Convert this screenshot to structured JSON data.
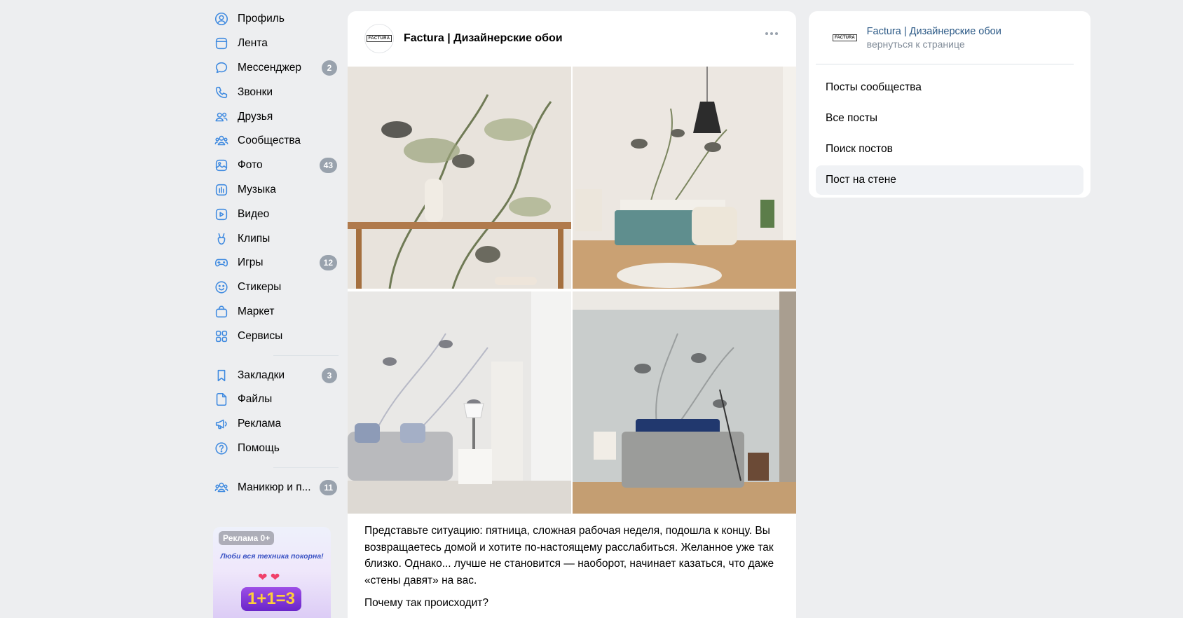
{
  "nav": {
    "items": [
      {
        "id": "profile",
        "label": "Профиль",
        "icon": "user-circle-icon",
        "badge": ""
      },
      {
        "id": "feed",
        "label": "Лента",
        "icon": "feed-icon",
        "badge": ""
      },
      {
        "id": "messenger",
        "label": "Мессенджер",
        "icon": "chat-bubble-icon",
        "badge": "2"
      },
      {
        "id": "calls",
        "label": "Звонки",
        "icon": "phone-icon",
        "badge": ""
      },
      {
        "id": "friends",
        "label": "Друзья",
        "icon": "friends-icon",
        "badge": ""
      },
      {
        "id": "communities",
        "label": "Сообщества",
        "icon": "communities-icon",
        "badge": ""
      },
      {
        "id": "photos",
        "label": "Фото",
        "icon": "photo-icon",
        "badge": "43"
      },
      {
        "id": "music",
        "label": "Музыка",
        "icon": "music-icon",
        "badge": ""
      },
      {
        "id": "video",
        "label": "Видео",
        "icon": "video-icon",
        "badge": ""
      },
      {
        "id": "clips",
        "label": "Клипы",
        "icon": "clips-icon",
        "badge": ""
      },
      {
        "id": "games",
        "label": "Игры",
        "icon": "gamepad-icon",
        "badge": "12"
      },
      {
        "id": "stickers",
        "label": "Стикеры",
        "icon": "smile-icon",
        "badge": ""
      },
      {
        "id": "market",
        "label": "Маркет",
        "icon": "shopping-bag-icon",
        "badge": ""
      },
      {
        "id": "services",
        "label": "Сервисы",
        "icon": "grid-icon",
        "badge": ""
      }
    ],
    "items2": [
      {
        "id": "bookmarks",
        "label": "Закладки",
        "icon": "bookmark-icon",
        "badge": "3"
      },
      {
        "id": "files",
        "label": "Файлы",
        "icon": "file-icon",
        "badge": ""
      },
      {
        "id": "ads",
        "label": "Реклама",
        "icon": "megaphone-icon",
        "badge": ""
      },
      {
        "id": "help",
        "label": "Помощь",
        "icon": "help-icon",
        "badge": ""
      }
    ],
    "items3": [
      {
        "id": "manicure",
        "label": "Маникюр и п...",
        "icon": "communities-icon",
        "badge": "11"
      }
    ]
  },
  "ad": {
    "tag": "Реклама 0+",
    "text": "Люби вся техника покорна!",
    "big": "1+1=3"
  },
  "post": {
    "author": "Factura | Дизайнерские обои",
    "logo": "FACTURA",
    "paragraphs": [
      "Представьте ситуацию: пятница, сложная рабочая неделя, подошла к концу. Вы возвращаетесь домой и хотите по-настоящему расслабиться. Желанное уже так близко. Однако... лучше не становится — наоборот, начинает казаться, что даже «стены давят» на вас.",
      "Почему так происходит?"
    ]
  },
  "side": {
    "logo": "FACTURA",
    "name": "Factura | Дизайнерские обои",
    "back": "вернуться к странице",
    "items": [
      "Посты сообщества",
      "Все посты",
      "Поиск постов",
      "Пост на стене"
    ],
    "active_index": 3
  },
  "colors": {
    "accent": "#3f8ae0",
    "badge": "#99a2ad",
    "link": "#2a5885",
    "background": "#edeef0"
  }
}
